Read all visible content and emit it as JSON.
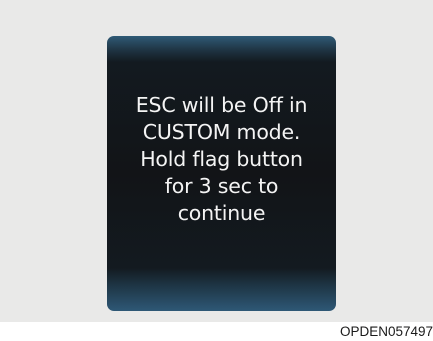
{
  "display": {
    "message_lines": [
      "ESC will be Off in",
      "CUSTOM mode.",
      "Hold flag button",
      "for 3 sec to",
      "continue"
    ]
  },
  "figure_code": "OPDEN057497"
}
